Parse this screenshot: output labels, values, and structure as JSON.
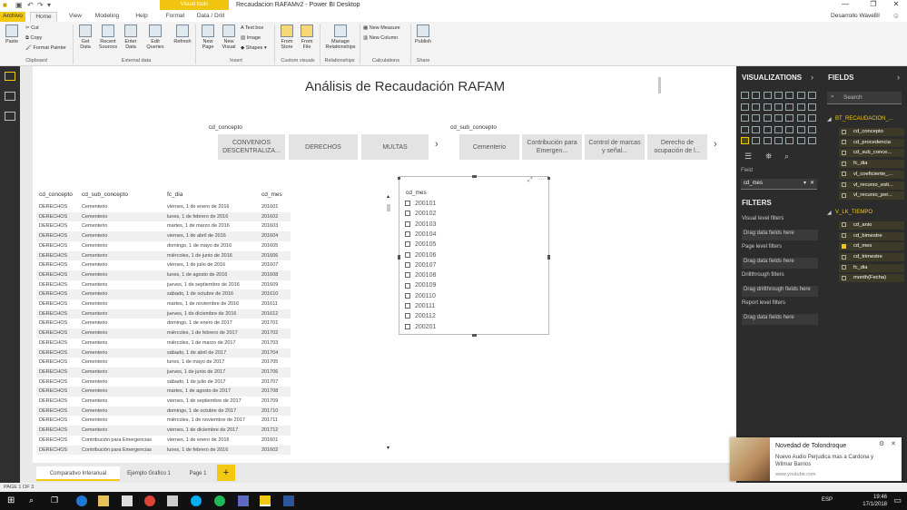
{
  "window": {
    "title": "Recaudacion RAFAMv2 - Power BI Desktop",
    "context_tab": "Visual tools",
    "user": "Desarrollo WaveBI"
  },
  "ribbon_tabs": [
    "Archivo",
    "Home",
    "View",
    "Modeling",
    "Help",
    "Format",
    "Data / Drill"
  ],
  "ribbon": {
    "paste": "Paste",
    "cut": "Cut",
    "copy": "Copy",
    "format_painter": "Format Painter",
    "clipboard": "Clipboard",
    "get_data": "Get Data",
    "recent_sources": "Recent Sources",
    "enter_data": "Enter Data",
    "edit_queries": "Edit Queries",
    "refresh": "Refresh",
    "external_data": "External data",
    "new_page": "New Page",
    "new_visual": "New Visual",
    "text_box": "Text box",
    "image": "Image",
    "shapes": "Shapes",
    "insert": "Insert",
    "from_store": "From Store",
    "from_file": "From File",
    "custom_visuals": "Custom visuals",
    "manage_relationships": "Manage Relationships",
    "relationships": "Relationships",
    "new_measure": "New Measure",
    "new_column": "New Column",
    "calculations": "Calculations",
    "publish": "Publish",
    "share": "Share"
  },
  "report": {
    "title": "Análisis de Recaudación RAFAM",
    "concepto_label": "cd_concepto",
    "sub_concepto_label": "cd_sub_concepto",
    "concepto_tiles": [
      "CONVENIOS DESCENTRALIZA...",
      "DERECHOS",
      "MULTAS"
    ],
    "sub_concepto_tiles": [
      "Cementerio",
      "Contribución para Emergen...",
      "Control de marcas y señal...",
      "Derecho de ocupación de l..."
    ]
  },
  "table": {
    "headers": [
      "cd_concepto",
      "cd_sub_concepto",
      "fc_dia",
      "cd_mes"
    ],
    "rows": [
      [
        "DERECHOS",
        "Cementerio",
        "viernes, 1 de enero de 2016",
        "201601"
      ],
      [
        "DERECHOS",
        "Cementerio",
        "lunes, 1 de febrero de 2016",
        "201602"
      ],
      [
        "DERECHOS",
        "Cementerio",
        "martes, 1 de marzo de 2016",
        "201603"
      ],
      [
        "DERECHOS",
        "Cementerio",
        "viernes, 1 de abril de 2016",
        "201604"
      ],
      [
        "DERECHOS",
        "Cementerio",
        "domingo, 1 de mayo de 2016",
        "201605"
      ],
      [
        "DERECHOS",
        "Cementerio",
        "miércoles, 1 de junio de 2016",
        "201606"
      ],
      [
        "DERECHOS",
        "Cementerio",
        "viernes, 1 de julio de 2016",
        "201607"
      ],
      [
        "DERECHOS",
        "Cementerio",
        "lunes, 1 de agosto de 2016",
        "201608"
      ],
      [
        "DERECHOS",
        "Cementerio",
        "jueves, 1 de septiembre de 2016",
        "201609"
      ],
      [
        "DERECHOS",
        "Cementerio",
        "sábado, 1 de octubre de 2016",
        "201610"
      ],
      [
        "DERECHOS",
        "Cementerio",
        "martes, 1 de noviembre de 2016",
        "201611"
      ],
      [
        "DERECHOS",
        "Cementerio",
        "jueves, 1 de diciembre de 2016",
        "201612"
      ],
      [
        "DERECHOS",
        "Cementerio",
        "domingo, 1 de enero de 2017",
        "201701"
      ],
      [
        "DERECHOS",
        "Cementerio",
        "miércoles, 1 de febrero de 2017",
        "201702"
      ],
      [
        "DERECHOS",
        "Cementerio",
        "miércoles, 1 de marzo de 2017",
        "201703"
      ],
      [
        "DERECHOS",
        "Cementerio",
        "sábado, 1 de abril de 2017",
        "201704"
      ],
      [
        "DERECHOS",
        "Cementerio",
        "lunes, 1 de mayo de 2017",
        "201705"
      ],
      [
        "DERECHOS",
        "Cementerio",
        "jueves, 1 de junio de 2017",
        "201706"
      ],
      [
        "DERECHOS",
        "Cementerio",
        "sábado, 1 de julio de 2017",
        "201707"
      ],
      [
        "DERECHOS",
        "Cementerio",
        "martes, 1 de agosto de 2017",
        "201708"
      ],
      [
        "DERECHOS",
        "Cementerio",
        "viernes, 1 de septiembre de 2017",
        "201709"
      ],
      [
        "DERECHOS",
        "Cementerio",
        "domingo, 1 de octubre de 2017",
        "201710"
      ],
      [
        "DERECHOS",
        "Cementerio",
        "miércoles, 1 de noviembre de 2017",
        "201711"
      ],
      [
        "DERECHOS",
        "Cementerio",
        "viernes, 1 de diciembre de 2017",
        "201712"
      ],
      [
        "DERECHOS",
        "Contribución para Emergencias",
        "viernes, 1 de enero de 2016",
        "201601"
      ],
      [
        "DERECHOS",
        "Contribución para Emergencias",
        "lunes, 1 de febrero de 2016",
        "201602"
      ]
    ]
  },
  "mes_slicer": {
    "title": "cd_mes",
    "items": [
      "200101",
      "200102",
      "200103",
      "200104",
      "200105",
      "200106",
      "200107",
      "200108",
      "200109",
      "200110",
      "200111",
      "200112",
      "200201"
    ]
  },
  "page_tabs": [
    "Comparativo Interanual",
    "Ejemplo Grafico 1",
    "Page 1"
  ],
  "status": "PAGE 1 OF 3",
  "visualizations": {
    "header": "VISUALIZATIONS",
    "field_label": "Field",
    "field_value": "cd_mes",
    "filters_header": "FILTERS",
    "filters": [
      "Visual level filters",
      "Drag data fields here",
      "Page level filters",
      "Drag data fields here",
      "Drillthrough filters",
      "Drag drillthrough fields here",
      "Report level filters",
      "Drag data fields here"
    ]
  },
  "fields": {
    "header": "FIELDS",
    "search_placeholder": "Search",
    "tables": [
      {
        "name": "BT_RECAUDACION_...",
        "fields": [
          "cd_concepto",
          "cd_procedencia",
          "cd_sub_conce...",
          "fc_dia",
          "vl_coeficiente_...",
          "vl_recurso_esti...",
          "vl_recurso_per..."
        ],
        "checked": [
          false,
          false,
          false,
          false,
          false,
          false,
          false
        ]
      },
      {
        "name": "V_LK_TIEMPO",
        "fields": [
          "cd_anio",
          "cd_bimestre",
          "cd_mes",
          "cd_trimestre",
          "fc_dia",
          "month(Fecha)"
        ],
        "checked": [
          false,
          false,
          true,
          false,
          false,
          false
        ]
      }
    ]
  },
  "notification": {
    "title": "Novedad de Tolondroque",
    "body": "Nuevo Audio Perjudica mas a Cardona y Wilmar Barrios",
    "source": "www.youtube.com"
  },
  "taskbar": {
    "lang": "ESP",
    "time": "19:46",
    "date": "17/1/2018"
  },
  "colors": {
    "accent": "#f2c811",
    "panel": "#2c2c2c"
  }
}
